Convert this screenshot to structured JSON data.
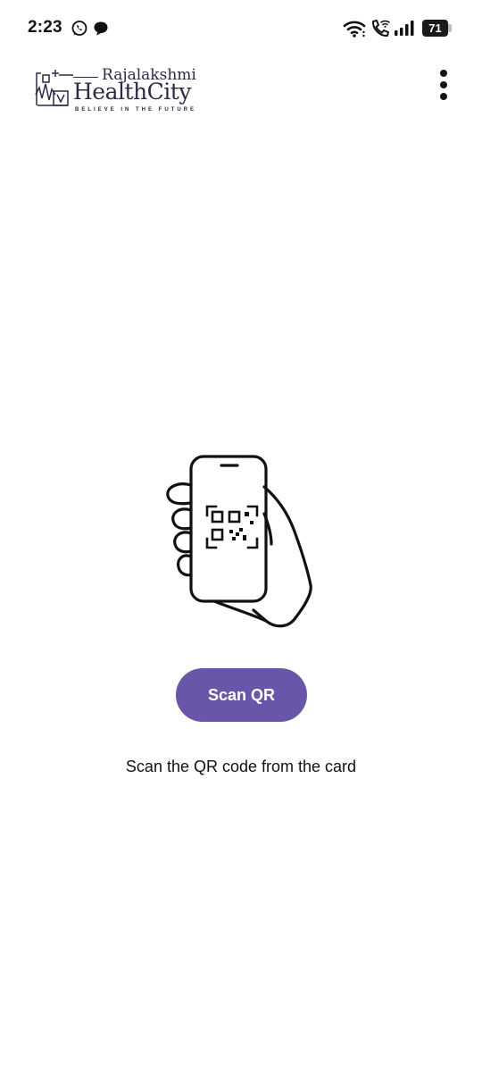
{
  "status_bar": {
    "time": "2:23",
    "battery_level": "71",
    "icons": [
      "whatsapp-icon",
      "chat-bubble-icon",
      "wifi-icon",
      "wifi-calling-icon",
      "signal-icon",
      "battery-icon"
    ]
  },
  "app_bar": {
    "logo": {
      "name_top": "Rajalakshmi",
      "name_main": "HealthCity",
      "tagline": "BELIEVE IN THE FUTURE"
    },
    "menu_icon": "more-vertical-icon"
  },
  "main": {
    "illustration_icon": "hand-phone-qr-icon",
    "scan_button_label": "Scan QR",
    "instruction": "Scan the QR code from the card"
  },
  "colors": {
    "primary": "#6a56a8",
    "background": "#ffffff",
    "logo": "#2b2b47"
  }
}
